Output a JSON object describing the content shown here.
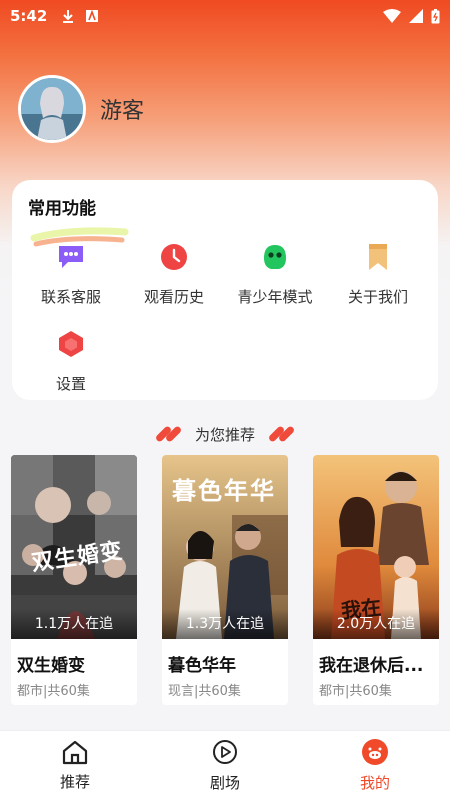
{
  "status_bar": {
    "time": "5:42"
  },
  "profile": {
    "name": "游客"
  },
  "functions": {
    "title": "常用功能",
    "items": [
      {
        "label": "联系客服",
        "icon": "chat-bubble-icon",
        "color": "#8b5cf6"
      },
      {
        "label": "观看历史",
        "icon": "clock-icon",
        "color": "#ef4444"
      },
      {
        "label": "青少年模式",
        "icon": "green-mascot-icon",
        "color": "#22c55e"
      },
      {
        "label": "关于我们",
        "icon": "bookmark-icon",
        "color": "#f2c27a"
      },
      {
        "label": "设置",
        "icon": "hexagon-settings-icon",
        "color": "#ef4444"
      }
    ]
  },
  "recommend": {
    "title": "为您推荐",
    "dramas": [
      {
        "name": "双生婚变",
        "meta": "都市|共60集",
        "watching": "1.1万人在追",
        "poster_text": "双生婚变"
      },
      {
        "name": "暮色华年",
        "meta": "现言|共60集",
        "watching": "1.3万人在追",
        "poster_text": "暮色年华"
      },
      {
        "name": "我在退休后...",
        "meta": "都市|共60集",
        "watching": "2.0万人在追",
        "poster_text": "我在"
      }
    ]
  },
  "tabbar": {
    "tabs": [
      {
        "label": "推荐",
        "icon": "home-icon",
        "active": false
      },
      {
        "label": "剧场",
        "icon": "play-circle-icon",
        "active": false
      },
      {
        "label": "我的",
        "icon": "pig-face-icon",
        "active": true
      }
    ]
  },
  "colors": {
    "accent": "#f04a2a",
    "header_top": "#f04a22"
  }
}
